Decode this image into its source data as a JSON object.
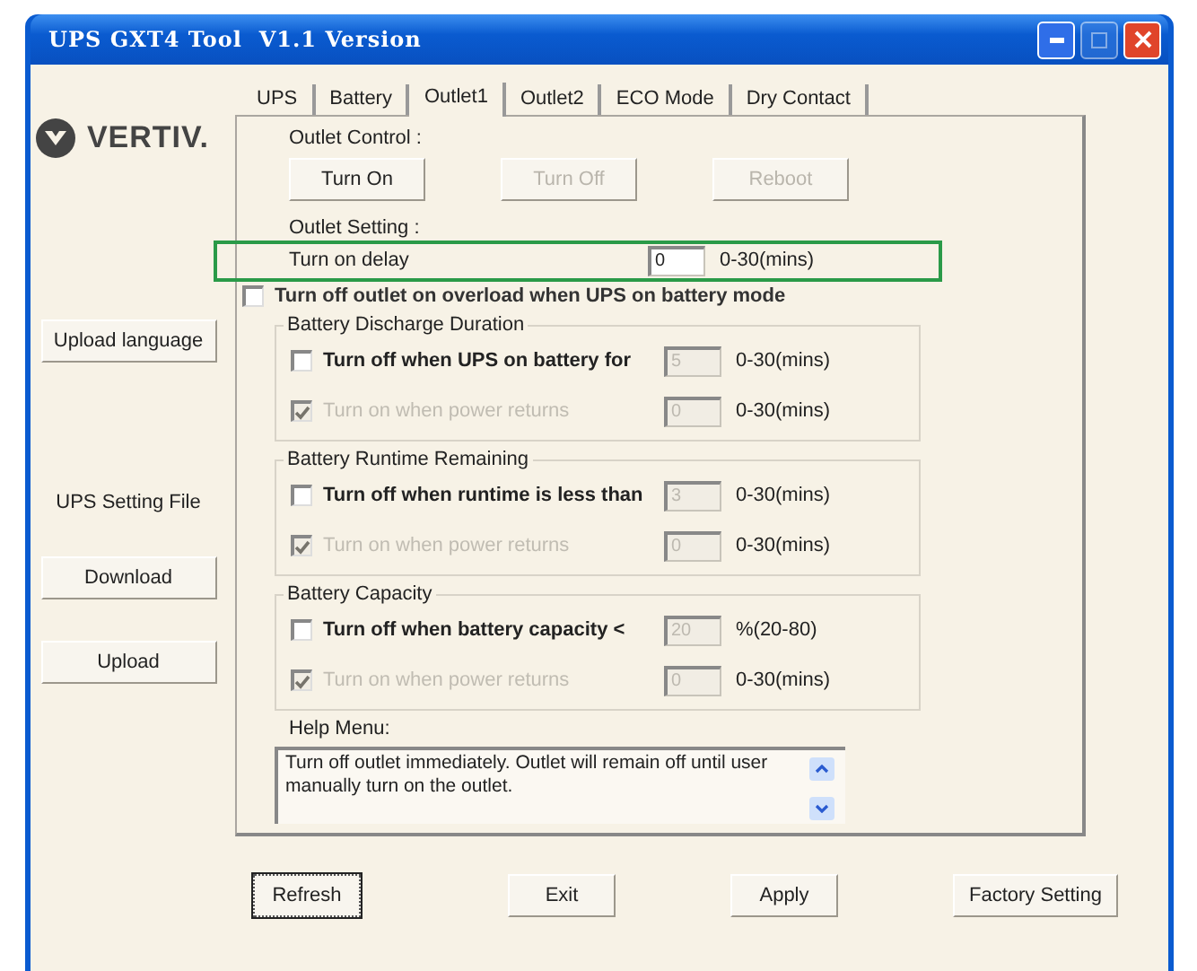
{
  "window": {
    "title": "UPS GXT4 Tool  V1.1 Version"
  },
  "brand": {
    "name": "VERTIV."
  },
  "sidebar": {
    "upload_language": "Upload language",
    "file_label": "UPS Setting File",
    "buttons": [
      "Download",
      "Upload"
    ]
  },
  "tabs": [
    {
      "label": "UPS",
      "selected": false
    },
    {
      "label": "Battery",
      "selected": false
    },
    {
      "label": "Outlet1",
      "selected": true
    },
    {
      "label": "Outlet2",
      "selected": false
    },
    {
      "label": "ECO Mode",
      "selected": false
    },
    {
      "label": "Dry Contact",
      "selected": false
    }
  ],
  "outlet_control": {
    "label": "Outlet Control :",
    "buttons": [
      {
        "label": "Turn On",
        "disabled": false
      },
      {
        "label": "Turn Off",
        "disabled": true
      },
      {
        "label": "Reboot",
        "disabled": true
      }
    ]
  },
  "outlet_setting": {
    "label": "Outlet Setting :",
    "delay": {
      "label": "Turn on delay",
      "value": "0",
      "range": "0-30(mins)",
      "highlighted": true
    },
    "overload": {
      "label": "Turn off outlet on overload when UPS on battery mode",
      "checked": false
    }
  },
  "groups": [
    {
      "title": "Battery Discharge Duration",
      "rows": [
        {
          "label": "Turn off when UPS on battery for",
          "checked": false,
          "disabled": false,
          "value": "5",
          "field_disabled": true,
          "unit": "0-30(mins)"
        },
        {
          "label": "Turn on when power returns",
          "checked": true,
          "disabled": true,
          "value": "0",
          "field_disabled": true,
          "unit": "0-30(mins)"
        }
      ]
    },
    {
      "title": "Battery Runtime Remaining",
      "rows": [
        {
          "label": "Turn off when runtime is less than",
          "checked": false,
          "disabled": false,
          "value": "3",
          "field_disabled": true,
          "unit": "0-30(mins)"
        },
        {
          "label": "Turn on when power returns",
          "checked": true,
          "disabled": true,
          "value": "0",
          "field_disabled": true,
          "unit": "0-30(mins)"
        }
      ]
    },
    {
      "title": "Battery Capacity",
      "rows": [
        {
          "label": "Turn off when battery capacity <",
          "checked": false,
          "disabled": false,
          "value": "20",
          "field_disabled": true,
          "unit": "%(20-80)"
        },
        {
          "label": "Turn on when power returns",
          "checked": true,
          "disabled": true,
          "value": "0",
          "field_disabled": true,
          "unit": "0-30(mins)"
        }
      ]
    }
  ],
  "help": {
    "label": "Help Menu:",
    "text": "Turn off outlet immediately. Outlet will remain off until user manually turn on the outlet."
  },
  "buttons": [
    {
      "label": "Refresh",
      "focused": true
    },
    {
      "label": "Exit",
      "focused": false
    },
    {
      "label": "Apply",
      "focused": false
    },
    {
      "label": "Factory Setting",
      "focused": false
    }
  ]
}
